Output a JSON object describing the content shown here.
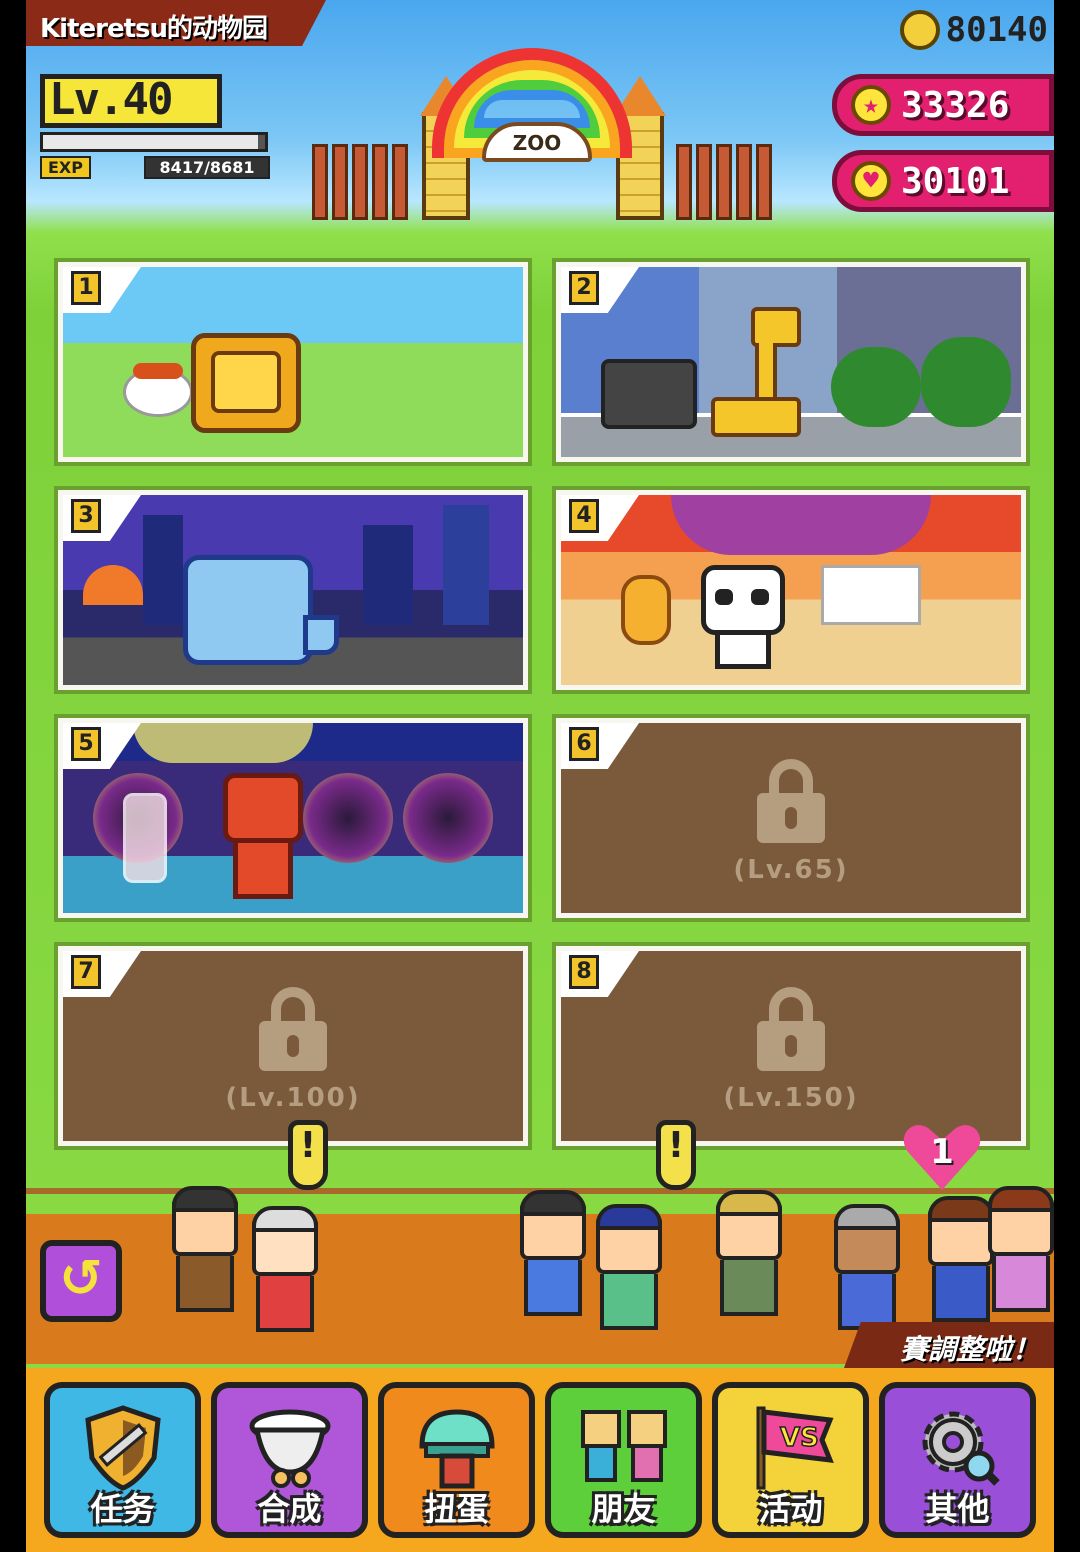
{
  "header": {
    "zoo_name": "Kiteretsu的动物园",
    "level": "Lv.40",
    "exp_label": "EXP",
    "exp_value": "8417/8681",
    "exp_progress": 0.97,
    "coins": "80140",
    "stars": "33326",
    "hearts": "30101",
    "gate_sign": "ZOO"
  },
  "areas": [
    {
      "number": "1",
      "locked": false,
      "animal": "lion",
      "theme": "meadow"
    },
    {
      "number": "2",
      "locked": false,
      "animal": "giraffe",
      "theme": "city"
    },
    {
      "number": "3",
      "locked": false,
      "animal": "elephant",
      "theme": "night-city"
    },
    {
      "number": "4",
      "locked": false,
      "animal": "panda",
      "theme": "sunset"
    },
    {
      "number": "5",
      "locked": false,
      "animal": "monkey",
      "theme": "psychedelic"
    },
    {
      "number": "6",
      "locked": true,
      "requirement": "(Lv.65)"
    },
    {
      "number": "7",
      "locked": true,
      "requirement": "(Lv.100)"
    },
    {
      "number": "8",
      "locked": true,
      "requirement": "(Lv.150)"
    }
  ],
  "plaza": {
    "alert_mark": "!",
    "notification_count": "1",
    "promo_text": "賽調整啦！"
  },
  "nav": [
    {
      "label": "任务",
      "icon": "shield-sword-icon",
      "color": "#3fb8e6"
    },
    {
      "label": "合成",
      "icon": "pot-icon",
      "color": "#b056d9"
    },
    {
      "label": "扭蛋",
      "icon": "capsule-icon",
      "color": "#f08a1c"
    },
    {
      "label": "朋友",
      "icon": "friends-icon",
      "color": "#5ccf3a"
    },
    {
      "label": "活动",
      "icon": "vs-flag-icon",
      "color": "#f4d23a"
    },
    {
      "label": "其他",
      "icon": "gear-icon",
      "color": "#9a4fd9"
    }
  ]
}
